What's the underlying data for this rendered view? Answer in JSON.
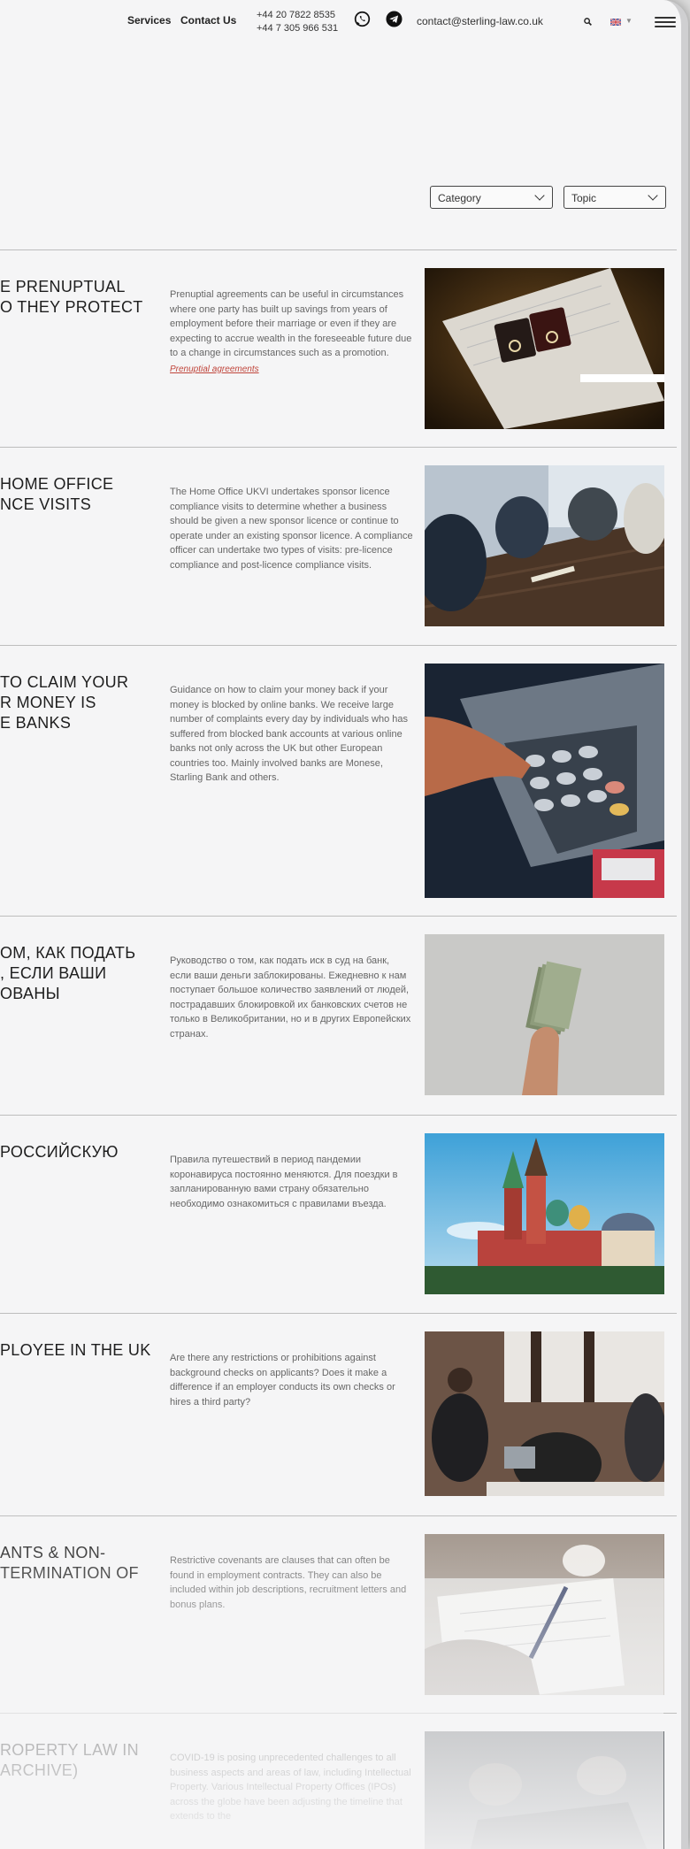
{
  "header": {
    "nav": [
      "Services",
      "Contact Us"
    ],
    "phones": [
      "+44 20 7822 8535",
      "+44 7 305 966 531"
    ],
    "email": "contact@sterling-law.co.uk"
  },
  "filters": {
    "category": "Category",
    "topic": "Topic"
  },
  "articles": [
    {
      "title": "E PRENUPTUAL\nO THEY PROTECT",
      "excerpt": "Prenuptial agreements can be useful in circumstances where one party has built up savings from years of employment before their marriage or even if they are expecting to accrue wealth in the foreseeable future due to a change in circumstances such as a promotion.",
      "tag": "Prenuptial agreements",
      "image": "rings-box-icon"
    },
    {
      "title": "HOME OFFICE\nNCE VISITS",
      "excerpt": "The Home Office UKVI undertakes sponsor licence compliance visits to determine whether a business should be given a new sponsor licence or continue to operate under an existing sponsor licence. A compliance officer can undertake two types of visits: pre-licence compliance and post-licence compliance visits.",
      "tag": "",
      "image": "meeting-table-icon"
    },
    {
      "title": "TO CLAIM YOUR\nR MONEY IS\nE BANKS",
      "excerpt": "Guidance on how to claim your money back if your money is blocked by online banks. We receive large number of complaints every day by individuals who has suffered from blocked bank accounts at various online banks not only across the UK but other European countries too. Mainly involved banks are Monese, Starling Bank and others.",
      "tag": "",
      "image": "atm-keypad-icon"
    },
    {
      "title": "ОМ, КАК ПОДАТЬ\n, ЕСЛИ ВАШИ\nОВАНЫ",
      "excerpt": "Руководство о том, как подать иск в суд на банк, если ваши деньги заблокированы. Ежедневно к нам поступает большое количество заявлений от людей, пострадавших блокировкой их банковских счетов не только в Великобритании, но и в других Европейских странах.",
      "tag": "",
      "image": "cash-in-hand-icon"
    },
    {
      "title": "РОССИЙСКУЮ",
      "excerpt": "Правила путешествий в период пандемии коронавируса постоянно меняются. Для поездки в запланированную вами страну обязательно необходимо ознакомиться с правилами въезда.",
      "tag": "",
      "image": "cathedral-icon"
    },
    {
      "title": "PLOYEE IN THE UK",
      "excerpt": "Are there any restrictions or prohibitions against background checks on applicants? Does it make a difference if an employer conducts its own checks or hires a third party?",
      "tag": "",
      "image": "office-team-icon"
    },
    {
      "title": "ANTS & NON-\nTERMINATION OF",
      "excerpt": "Restrictive covenants are clauses that can often be found in employment contracts. They can also be included within job descriptions, recruitment letters and bonus plans.",
      "tag": "",
      "image": "writing-desk-icon"
    },
    {
      "title": "ROPERTY LAW IN\nARCHIVE)",
      "excerpt": "COVID-19 is posing unprecedented challenges to all business aspects and areas of law, including Intellectual Property. Various Intellectual Property Offices (IPOs) across the globe have been adjusting the timeline that extends to the",
      "tag": "",
      "image": "laptop-hands-icon"
    }
  ]
}
